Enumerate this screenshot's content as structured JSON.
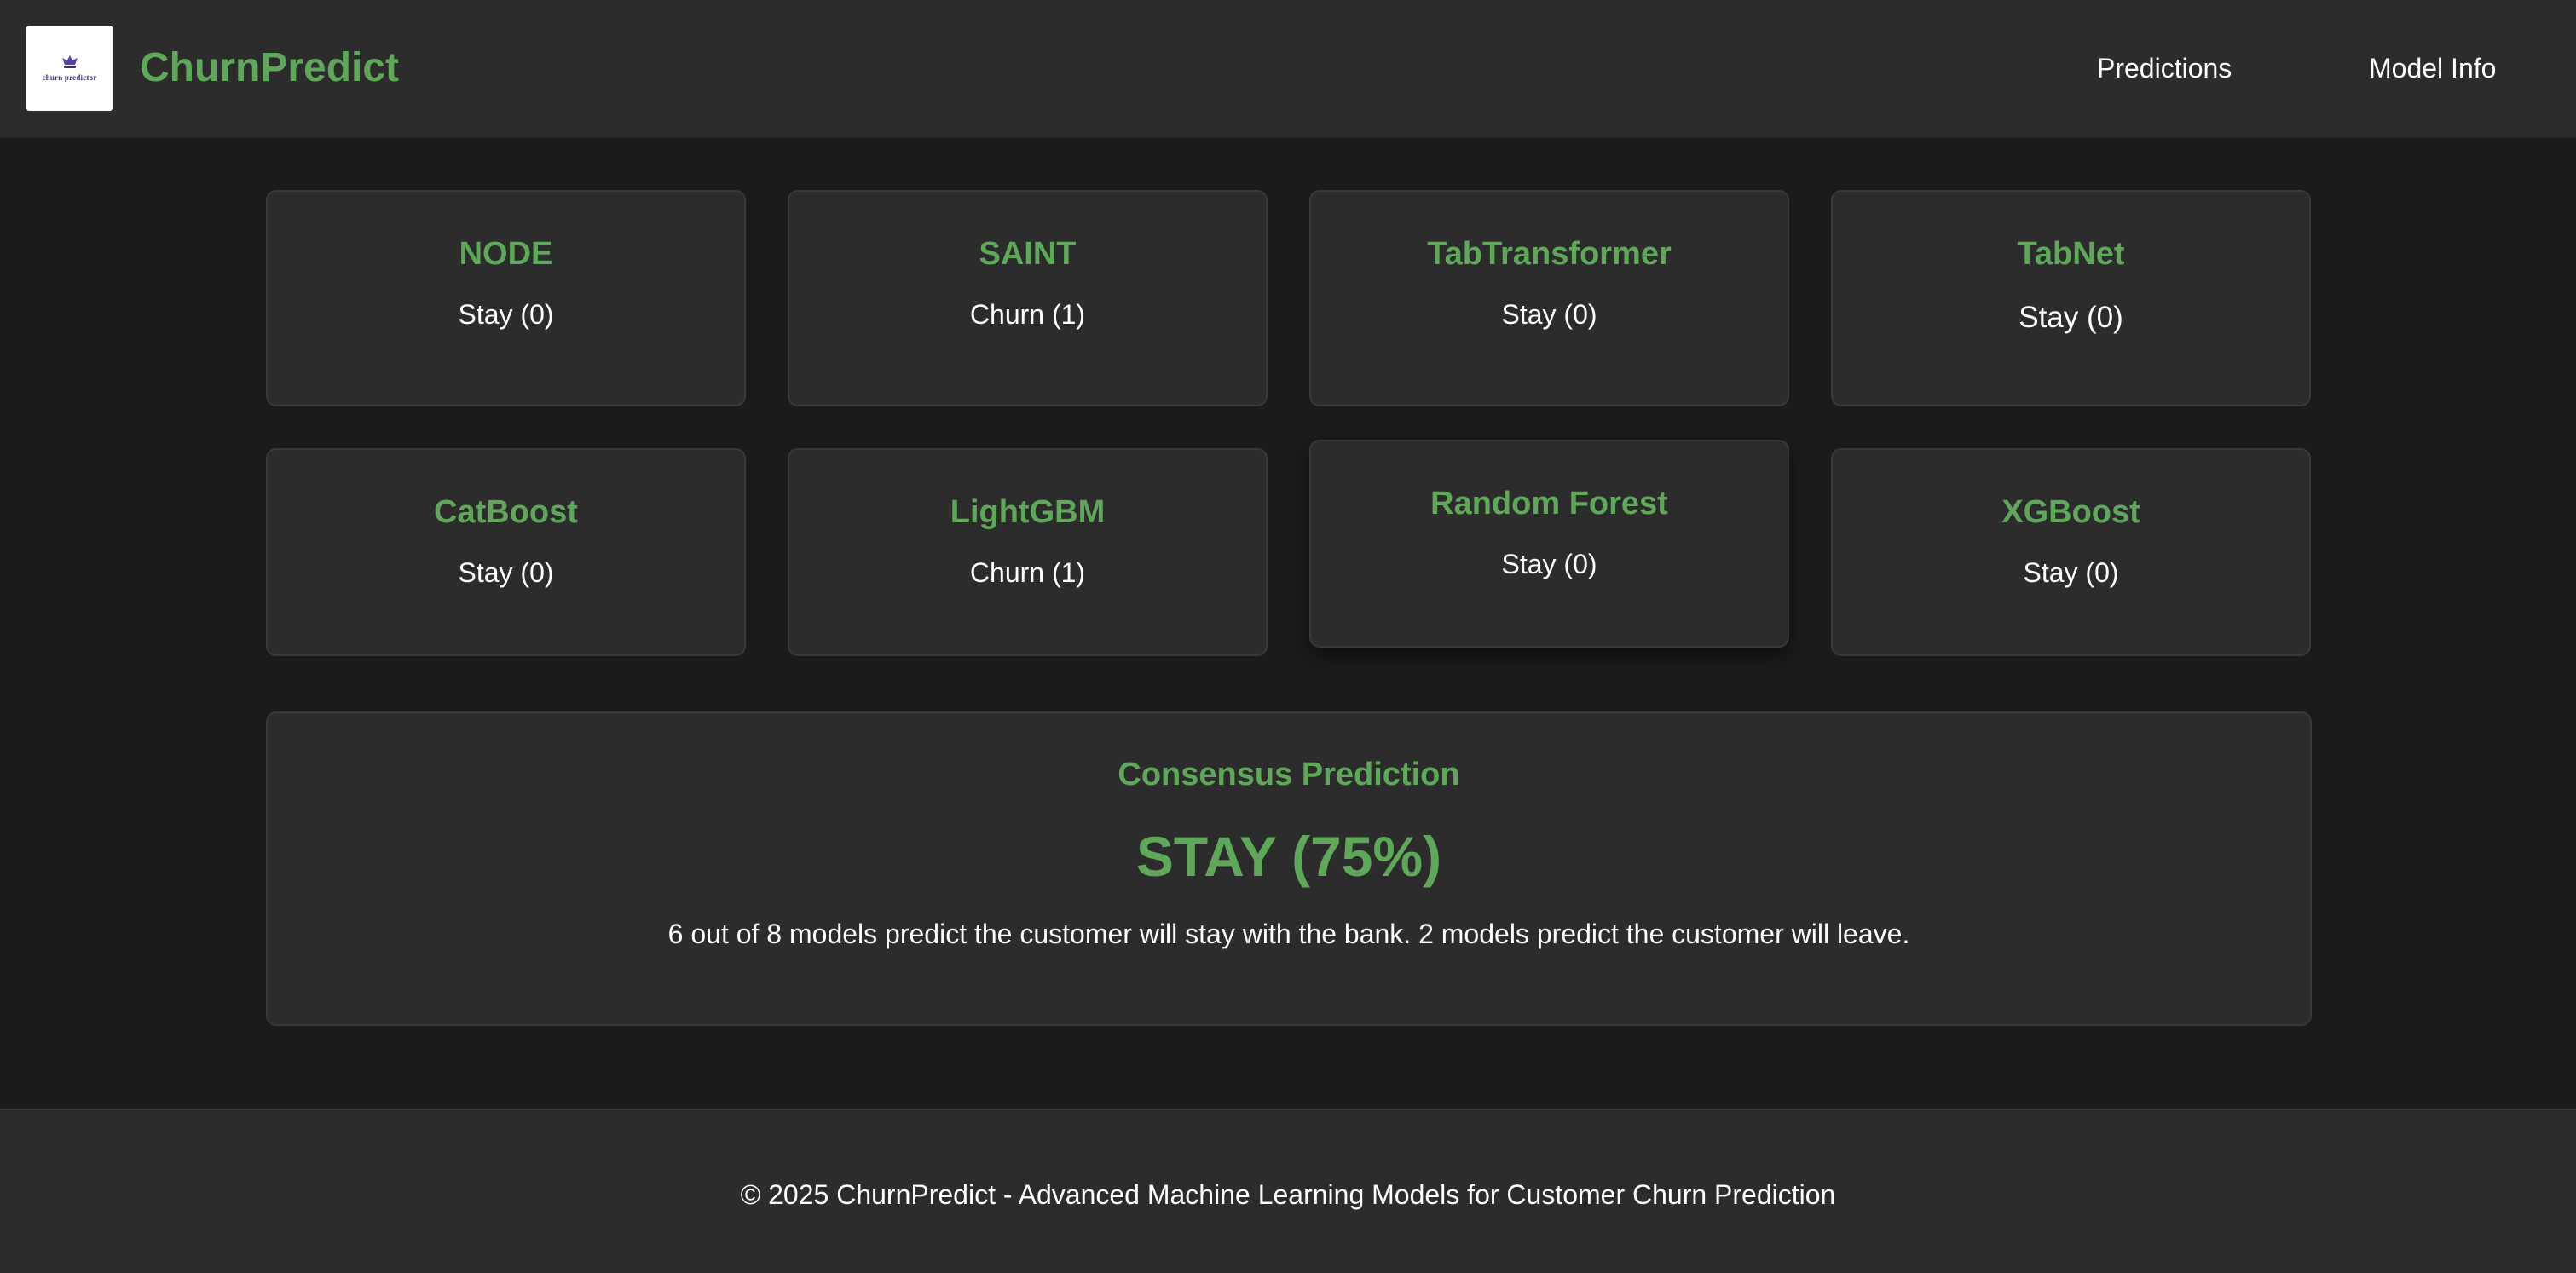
{
  "header": {
    "logo_text": "churn predictor",
    "brand": "ChurnPredict",
    "nav": {
      "predictions": "Predictions",
      "model_info": "Model Info"
    }
  },
  "models": [
    {
      "name": "NODE",
      "prediction": "Stay (0)"
    },
    {
      "name": "SAINT",
      "prediction": "Churn (1)"
    },
    {
      "name": "TabTransformer",
      "prediction": "Stay (0)"
    },
    {
      "name": "TabNet",
      "prediction": "Stay (0)"
    },
    {
      "name": "CatBoost",
      "prediction": "Stay (0)"
    },
    {
      "name": "LightGBM",
      "prediction": "Churn (1)"
    },
    {
      "name": "Random Forest",
      "prediction": "Stay (0)"
    },
    {
      "name": "XGBoost",
      "prediction": "Stay (0)"
    }
  ],
  "consensus": {
    "title": "Consensus Prediction",
    "result": "STAY (75%)",
    "description": "6 out of 8 models predict the customer will stay with the bank. 2 models predict the customer will leave."
  },
  "footer": {
    "text": "© 2025 ChurnPredict - Advanced Machine Learning Models for Customer Churn Prediction"
  },
  "colors": {
    "accent": "#5fa85a",
    "background": "#1b1b1b",
    "panel": "#2c2c2c"
  }
}
